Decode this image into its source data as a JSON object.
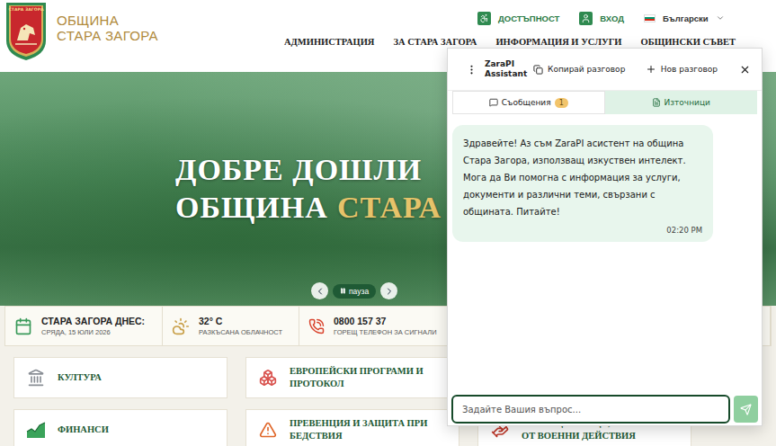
{
  "header": {
    "crest_label": "СТАРА ЗАГОРА",
    "name_lines": [
      "ОБЩИНА",
      "СТАРА ЗАГОРА"
    ],
    "utility": [
      {
        "label": "ДОСТЪПНОСТ"
      },
      {
        "label": "ВХОД"
      }
    ],
    "language": "Български",
    "nav": [
      "АДМИНИСТРАЦИЯ",
      "ЗА СТАРА ЗАГОРА",
      "ИНФОРМАЦИЯ И УСЛУГИ",
      "ОБЩИНСКИ СЪВЕТ"
    ]
  },
  "hero": {
    "title_lines": [
      [
        {
          "text": "ДОБРЕ ДОШЛИ",
          "highlight": false
        }
      ],
      [
        {
          "text": "ОБЩИНА",
          "highlight": false
        },
        {
          "text": "СТАРА ЗА",
          "highlight": true
        }
      ]
    ],
    "carousel": {
      "pause_label": "пауза"
    }
  },
  "today": {
    "title": "СТАРА ЗАГОРА ДНЕС:",
    "date": "СРЯДА, 15 ЮЛИ 2026"
  },
  "weather": {
    "temp": "32° C",
    "desc": "РАЗКЪСАНА ОБЛАЧНОСТ"
  },
  "hotline": {
    "number": "0800 157 37",
    "desc": "ГОРЕЩ ТЕЛЕФОН ЗА СИГНАЛИ"
  },
  "categories": {
    "columns": [
      [
        "КУЛТУРА",
        "ФИНАНСИ"
      ],
      [
        "ЕВРОПЕЙСКИ ПРОГРАМИ И ПРОТОКОЛ",
        "ПРЕВЕНЦИЯ И ЗАЩИТА ПРИ БЕДСТВИЯ"
      ],
      [
        "ПОМОЩ ЗА ЛИЦА, ЗАСЕГНАТИ ОТ ВОЕННИ ДЕЙСТВИЯ"
      ]
    ]
  },
  "chat": {
    "title": "ZaraPI Assistant",
    "actions": [
      "Копирай разговор",
      "Нов разговор"
    ],
    "tabs": [
      {
        "label": "Съобщения",
        "badge": "1",
        "selected": true
      },
      {
        "label": "Източници",
        "badge": "",
        "selected": false
      }
    ],
    "messages": [
      {
        "text": "Здравейте! Аз съм ZaraPI асистент на община Стара Загора, използващ изкуствен интелект. Мога да Ви помогна с информация за услуги, документи и различни теми, свързани с общината. Питайте!",
        "time": "02:20 PM"
      }
    ],
    "input": {
      "placeholder": "Задайте Вашия въпрос..."
    }
  }
}
